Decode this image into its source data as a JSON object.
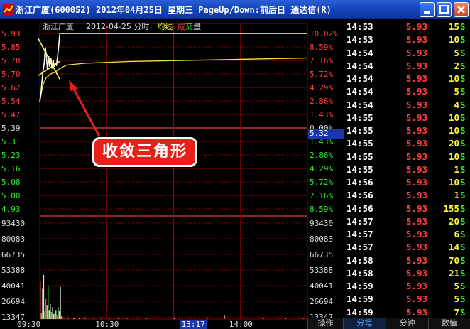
{
  "window": {
    "title": "浙江广厦(600052) 2012年04月25日 星期三 PageUp/Down:前后日 通达信(R)"
  },
  "chart_header": {
    "stock_name": "浙江广厦",
    "date_label": "2012-04-25 分时",
    "avg_label": "均线",
    "vol_label_1": "成",
    "vol_label_2": "交",
    "vol_label_3": "量"
  },
  "annotation": {
    "text": "收敛三角形"
  },
  "current_price_tag": "5.32",
  "colors": {
    "up": "#ff4040",
    "down": "#2ee82e",
    "price_line": "#ffffff",
    "avg_line": "#e8e840",
    "grid": "#8b0000"
  },
  "chart_data": {
    "type": "line",
    "price_ticks": [
      "5.93",
      "5.85",
      "5.78",
      "5.70",
      "5.62",
      "5.54",
      "5.47",
      "5.39",
      "5.31",
      "5.23",
      "5.16",
      "5.08",
      "5.00",
      "4.93"
    ],
    "pct_ticks": [
      "10.02%",
      "8.59%",
      "7.16%",
      "5.72%",
      "4.29%",
      "2.86%",
      "1.43%",
      "0.00%",
      "1.43%",
      "2.86%",
      "4.29%",
      "5.72%",
      "7.16%",
      "8.59%"
    ],
    "volume_ticks": [
      "93430",
      "80083",
      "66735",
      "53388",
      "40041",
      "26694",
      "13347"
    ],
    "time_ticks": [
      "09:30",
      "10:30",
      "13:17",
      "14:00"
    ],
    "ylim": [
      4.93,
      5.93
    ],
    "prev_close": 5.39,
    "price_series": [
      [
        0,
        5.54
      ],
      [
        1,
        5.58
      ],
      [
        2,
        5.66
      ],
      [
        3,
        5.72
      ],
      [
        4,
        5.76
      ],
      [
        5,
        5.85
      ],
      [
        6,
        5.79
      ],
      [
        7,
        5.72
      ],
      [
        8,
        5.8
      ],
      [
        9,
        5.74
      ],
      [
        10,
        5.79
      ],
      [
        11,
        5.73
      ],
      [
        12,
        5.78
      ],
      [
        13,
        5.74
      ],
      [
        14,
        5.76
      ],
      [
        15,
        5.75
      ],
      [
        16,
        5.8
      ],
      [
        17,
        5.86
      ],
      [
        18,
        5.93
      ],
      [
        20,
        5.93
      ],
      [
        240,
        5.93
      ]
    ],
    "avg_series": [
      [
        0,
        5.55
      ],
      [
        3,
        5.64
      ],
      [
        6,
        5.68
      ],
      [
        10,
        5.7
      ],
      [
        14,
        5.71
      ],
      [
        18,
        5.73
      ],
      [
        24,
        5.75
      ],
      [
        40,
        5.76
      ],
      [
        80,
        5.77
      ],
      [
        160,
        5.78
      ],
      [
        240,
        5.79
      ]
    ],
    "volume_series": [
      [
        0,
        38000
      ],
      [
        1,
        6000
      ],
      [
        2,
        30000
      ],
      [
        3,
        44000
      ],
      [
        4,
        8000
      ],
      [
        5,
        20000
      ],
      [
        6,
        14000
      ],
      [
        7,
        33000
      ],
      [
        8,
        9000
      ],
      [
        9,
        15000
      ],
      [
        10,
        7000
      ],
      [
        11,
        12000
      ],
      [
        12,
        5000
      ],
      [
        13,
        6000
      ],
      [
        14,
        9000
      ],
      [
        15,
        4000
      ],
      [
        16,
        12000
      ],
      [
        17,
        8000
      ],
      [
        18,
        32000
      ],
      [
        19,
        3000
      ],
      [
        20,
        2000
      ],
      [
        22,
        1500
      ],
      [
        25,
        1000
      ],
      [
        30,
        1200
      ],
      [
        35,
        800
      ],
      [
        40,
        1500
      ],
      [
        48,
        900
      ],
      [
        55,
        1200
      ],
      [
        62,
        700
      ],
      [
        70,
        600
      ],
      [
        78,
        900
      ],
      [
        88,
        500
      ],
      [
        95,
        700
      ],
      [
        120,
        600
      ],
      [
        125,
        900
      ],
      [
        150,
        600
      ],
      [
        165,
        4000
      ],
      [
        180,
        500
      ],
      [
        200,
        700
      ],
      [
        220,
        500
      ],
      [
        236,
        600
      ]
    ],
    "ylabel": "",
    "xlabel": ""
  },
  "ticks": [
    {
      "time": "14:53",
      "price": "5.93",
      "vol": "15",
      "side": "S"
    },
    {
      "time": "14:53",
      "price": "5.93",
      "vol": "10",
      "side": "S"
    },
    {
      "time": "14:54",
      "price": "5.93",
      "vol": "5",
      "side": "S"
    },
    {
      "time": "14:54",
      "price": "5.93",
      "vol": "2",
      "side": "S"
    },
    {
      "time": "14:54",
      "price": "5.93",
      "vol": "10",
      "side": "S"
    },
    {
      "time": "14:54",
      "price": "5.93",
      "vol": "5",
      "side": "S"
    },
    {
      "time": "14:54",
      "price": "5.93",
      "vol": "4",
      "side": "S"
    },
    {
      "time": "14:55",
      "price": "5.93",
      "vol": "10",
      "side": "S"
    },
    {
      "time": "14:55",
      "price": "5.93",
      "vol": "10",
      "side": "S"
    },
    {
      "time": "14:55",
      "price": "5.93",
      "vol": "20",
      "side": "S"
    },
    {
      "time": "14:55",
      "price": "5.93",
      "vol": "10",
      "side": "S"
    },
    {
      "time": "14:55",
      "price": "5.93",
      "vol": "1",
      "side": "S"
    },
    {
      "time": "14:56",
      "price": "5.93",
      "vol": "10",
      "side": "S"
    },
    {
      "time": "14:56",
      "price": "5.93",
      "vol": "1",
      "side": "S"
    },
    {
      "time": "14:56",
      "price": "5.93",
      "vol": "155",
      "side": "S"
    },
    {
      "time": "14:57",
      "price": "5.93",
      "vol": "20",
      "side": "S"
    },
    {
      "time": "14:57",
      "price": "5.93",
      "vol": "6",
      "side": "S"
    },
    {
      "time": "14:57",
      "price": "5.93",
      "vol": "14",
      "side": "S"
    },
    {
      "time": "14:58",
      "price": "5.93",
      "vol": "70",
      "side": "S"
    },
    {
      "time": "14:58",
      "price": "5.93",
      "vol": "21",
      "side": "S"
    },
    {
      "time": "14:59",
      "price": "5.93",
      "vol": "5",
      "side": "S"
    },
    {
      "time": "14:59",
      "price": "5.93",
      "vol": "5",
      "side": "S"
    },
    {
      "time": "14:59",
      "price": "5.93",
      "vol": "7",
      "side": "S"
    }
  ],
  "tabs": [
    {
      "label": "操作"
    },
    {
      "label": "分笔"
    },
    {
      "label": "分钟"
    },
    {
      "label": "数值"
    }
  ]
}
